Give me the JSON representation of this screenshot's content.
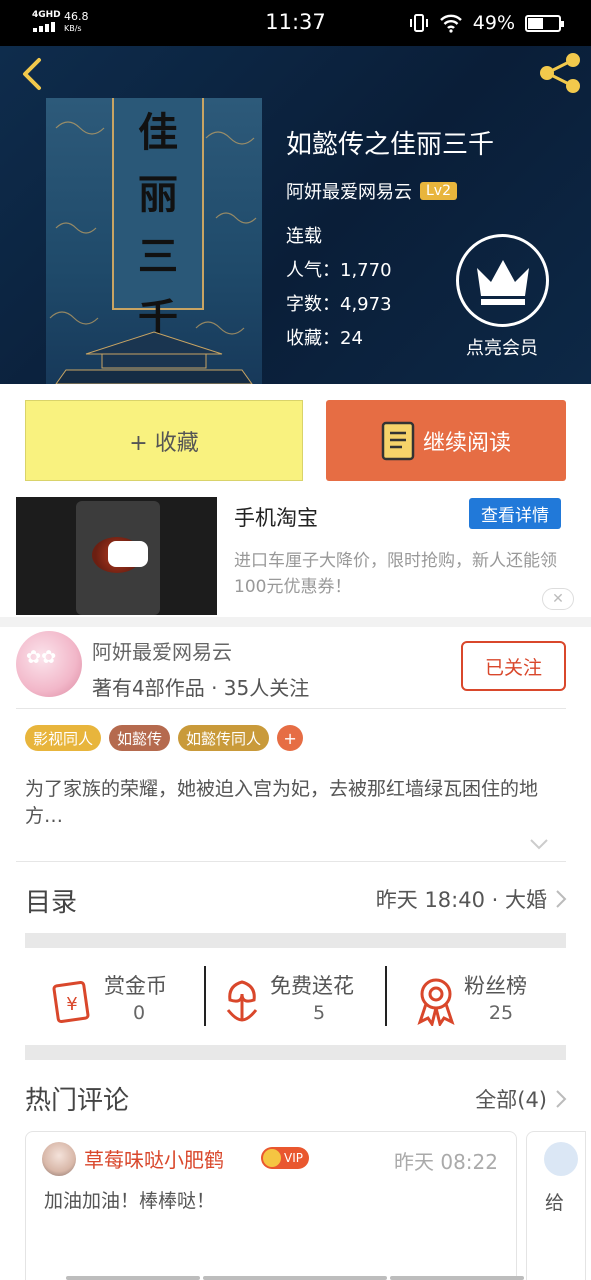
{
  "status_bar": {
    "network": "4GHD",
    "speed_value": "46.8",
    "speed_unit": "KB/s",
    "time": "11:37",
    "battery_percent": "49%",
    "battery_level": 0.49
  },
  "header": {
    "cover_chars": [
      "佳",
      "丽",
      "三",
      "千"
    ],
    "book_title": "如懿传之佳丽三千",
    "author": "阿妍最爱网易云",
    "level": "Lv2",
    "status": "连载",
    "popularity": "人气：1,770",
    "word_count": "字数：4,973",
    "favorites": "收藏：24",
    "vip_label": "点亮会员"
  },
  "actions": {
    "collect": "+ 收藏",
    "read": "继续阅读"
  },
  "ad": {
    "title": "手机淘宝",
    "detail_button": "查看详情",
    "description": "进口车厘子大降价，限时抢购，新人还能领100元优惠券！",
    "close": "✕"
  },
  "author_card": {
    "name": "阿妍最爱网易云",
    "stats": "著有4部作品 · 35人关注",
    "follow_button": "已关注"
  },
  "tags": [
    {
      "label": "影视同人",
      "color": "#e8b53c"
    },
    {
      "label": "如懿传",
      "color": "#b56a4e"
    },
    {
      "label": "如懿传同人",
      "color": "#c99a3a"
    }
  ],
  "tag_add": "+",
  "summary": "为了家族的荣耀，她被迫入宫为妃，去被那红墙绿瓦困住的地方…",
  "toc": {
    "title": "目录",
    "latest": "昨天 18:40 · 大婚"
  },
  "stats": [
    {
      "label": "赏金币",
      "value": "0",
      "icon": "red-envelope-icon"
    },
    {
      "label": "免费送花",
      "value": "5",
      "icon": "flower-icon"
    },
    {
      "label": "粉丝榜",
      "value": "25",
      "icon": "medal-icon"
    }
  ],
  "comments": {
    "title": "热门评论",
    "all": "全部(4)",
    "items": [
      {
        "user": "草莓味哒小肥鹤",
        "badge": "VIP",
        "time": "昨天 08:22",
        "text": "加油加油！棒棒哒！"
      },
      {
        "text": "给"
      }
    ]
  },
  "colors": {
    "header_bg": "#0e2c4c",
    "accent_orange": "#e66d44",
    "collect_yellow": "#f9f27f",
    "follow_red": "#d9472b",
    "ad_blue": "#2179d9"
  }
}
